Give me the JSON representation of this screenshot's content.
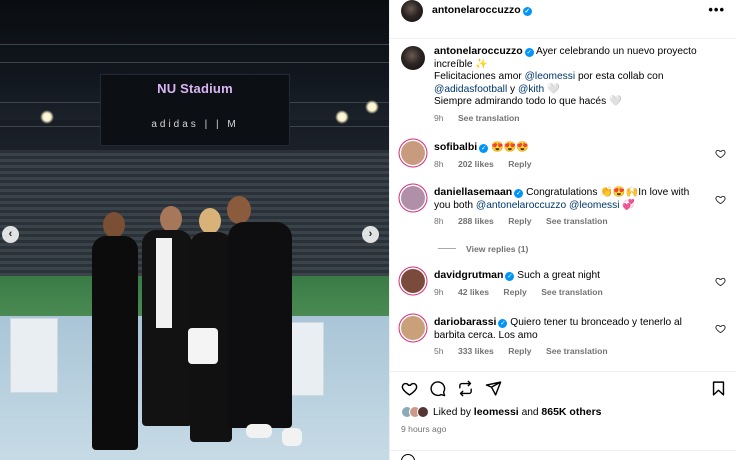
{
  "post": {
    "author": "antonelaroccuzzo",
    "scoreboard_title": "NU Stadium",
    "scoreboard_logos": "adidas | | M",
    "prev_glyph": "‹",
    "next_glyph": "›",
    "more_glyph": "•••"
  },
  "caption": {
    "username": "antonelaroccuzzo",
    "line1_a": "Ayer celebrando un nuevo proyecto increíble ✨",
    "line2_a": "Felicitaciones amor ",
    "line2_mention": "@leomessi",
    "line2_b": " por esta collab con",
    "line3_mention1": "@adidasfootball",
    "line3_mid": " y ",
    "line3_mention2": "@kith",
    "line3_b": " 🤍",
    "line4": "Siempre admirando todo lo que hacés 🤍",
    "time": "9h",
    "see_translation": "See translation"
  },
  "comments": [
    {
      "username": "sofibalbi",
      "text": "😍😍😍",
      "time": "8h",
      "likes": "202 likes",
      "reply": "Reply",
      "avatar_color": "#c99b7e"
    },
    {
      "username": "daniellasemaan",
      "text_a": "Congratulations 👏😍🙌In love with you both ",
      "mention1": "@antonelaroccuzzo",
      "mention2": "@leomessi",
      "text_b": " 💞",
      "time": "8h",
      "likes": "288 likes",
      "reply": "Reply",
      "see_translation": "See translation",
      "view_replies": "View replies (1)",
      "avatar_color": "#b08fa8"
    },
    {
      "username": "davidgrutman",
      "text": "Such a great night",
      "time": "9h",
      "likes": "42 likes",
      "reply": "Reply",
      "see_translation": "See translation",
      "avatar_color": "#7a4a3a"
    },
    {
      "username": "dariobarassi",
      "text": "Quiero tener tu bronceado y tenerlo al barbita cerca. Los amo",
      "time": "5h",
      "likes": "333 likes",
      "reply": "Reply",
      "see_translation": "See translation",
      "avatar_color": "#c9a07a"
    }
  ],
  "likes": {
    "prefix": "Liked by ",
    "user": "leomessi",
    "middle": " and ",
    "count": "865K others"
  },
  "timestamp": "9 hours ago",
  "icons": {
    "like": "heart-icon",
    "comment": "comment-icon",
    "share": "repost-icon",
    "send": "send-icon",
    "save": "bookmark-icon"
  }
}
